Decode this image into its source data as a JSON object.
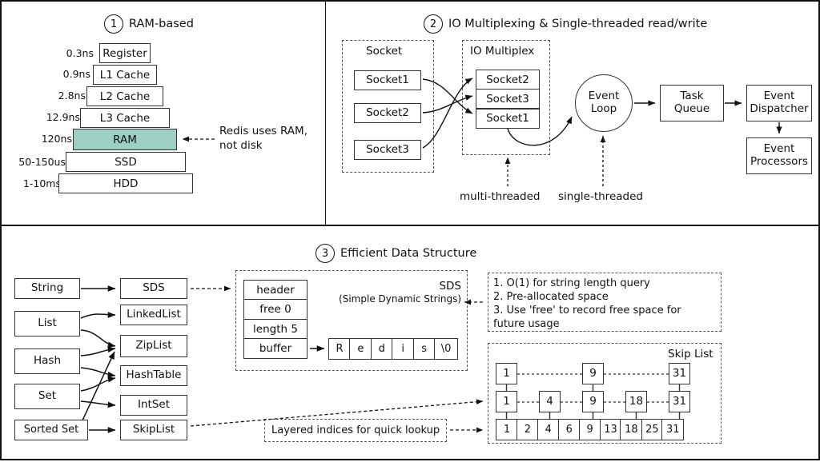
{
  "sections": [
    {
      "num": "1",
      "title": "RAM-based"
    },
    {
      "num": "2",
      "title": "IO Multiplexing & Single-threaded read/write"
    },
    {
      "num": "3",
      "title": "Efficient Data Structure"
    }
  ],
  "memory_pyramid": {
    "levels": [
      {
        "latency": "0.3ns",
        "name": "Register",
        "highlight": false
      },
      {
        "latency": "0.9ns",
        "name": "L1 Cache",
        "highlight": false
      },
      {
        "latency": "2.8ns",
        "name": "L2 Cache",
        "highlight": false
      },
      {
        "latency": "12.9ns",
        "name": "L3 Cache",
        "highlight": false
      },
      {
        "latency": "120ns",
        "name": "RAM",
        "highlight": true
      },
      {
        "latency": "50-150us",
        "name": "SSD",
        "highlight": false
      },
      {
        "latency": "1-10ms",
        "name": "HDD",
        "highlight": false
      }
    ],
    "annotation": "Redis uses RAM,\nnot disk",
    "annotation_line1": "Redis uses RAM,",
    "annotation_line2": "not disk",
    "highlight_color": "#9ecfc5"
  },
  "io_multiplexing": {
    "socket_group_label": "Socket",
    "sockets": [
      "Socket1",
      "Socket2",
      "Socket3"
    ],
    "multiplex_group_label": "IO Multiplex",
    "multiplex_entries": [
      "Socket2",
      "Socket3",
      "Socket1"
    ],
    "event_loop": "Event\nLoop",
    "event_loop_line1": "Event",
    "event_loop_line2": "Loop",
    "task_queue_line1": "Task",
    "task_queue_line2": "Queue",
    "event_dispatcher_line1": "Event",
    "event_dispatcher_line2": "Dispatcher",
    "event_processors_line1": "Event",
    "event_processors_line2": "Processors",
    "note_multi": "multi-threaded",
    "note_single": "single-threaded"
  },
  "data_structures": {
    "types": [
      "String",
      "List",
      "Hash",
      "Set",
      "Sorted Set"
    ],
    "encodings": [
      "SDS",
      "LinkedList",
      "ZipList",
      "HashTable",
      "IntSet",
      "SkipList"
    ],
    "mappings": [
      {
        "from": "String",
        "to": [
          "SDS"
        ]
      },
      {
        "from": "List",
        "to": [
          "LinkedList",
          "ZipList"
        ]
      },
      {
        "from": "Hash",
        "to": [
          "ZipList",
          "HashTable"
        ]
      },
      {
        "from": "Set",
        "to": [
          "HashTable",
          "IntSet"
        ]
      },
      {
        "from": "Sorted Set",
        "to": [
          "ZipList",
          "SkipList"
        ]
      }
    ]
  },
  "sds": {
    "title_line1": "SDS",
    "title_line2": "(Simple Dynamic Strings)",
    "fields": [
      "header",
      "free 0",
      "length 5",
      "buffer"
    ],
    "buffer_chars": [
      "R",
      "e",
      "d",
      "i",
      "s",
      "\\0"
    ],
    "notes_lines": [
      "1. O(1) for string length query",
      "2. Pre-allocated space",
      "3. Use 'free' to record free space for",
      "future usage"
    ]
  },
  "skip_list": {
    "title": "Skip List",
    "caption": "Layered indices for quick lookup",
    "level2": [
      "1",
      "9",
      "31"
    ],
    "level2_slots": [
      0,
      4,
      8
    ],
    "level1": [
      "1",
      "4",
      "9",
      "18",
      "31"
    ],
    "level1_slots": [
      0,
      2,
      4,
      6,
      8
    ],
    "level0": [
      "1",
      "2",
      "4",
      "6",
      "9",
      "13",
      "18",
      "25",
      "31"
    ]
  }
}
